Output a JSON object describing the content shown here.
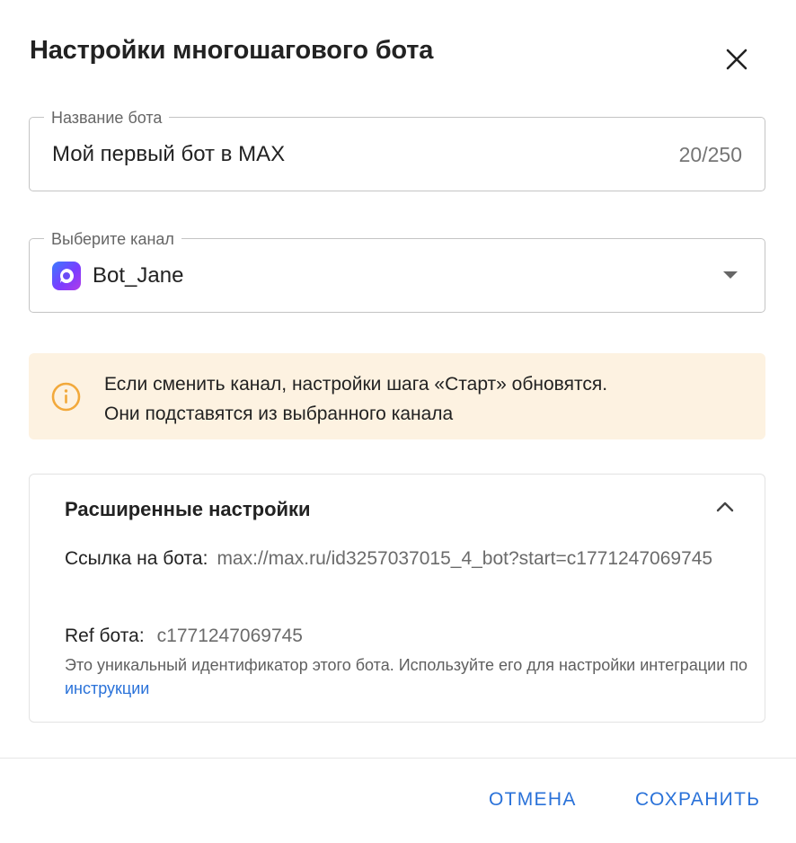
{
  "dialog": {
    "title": "Настройки многошагового бота",
    "close_icon": "close-icon"
  },
  "name_field": {
    "label": "Название бота",
    "value": "Мой первый бот в MAX",
    "counter": "20/250"
  },
  "channel_field": {
    "label": "Выберите канал",
    "icon": "max-messenger-icon",
    "value": "Bot_Jane",
    "arrow_icon": "dropdown-arrow-icon"
  },
  "alert": {
    "icon": "info-icon",
    "line1": "Если сменить канал, настройки шага «Старт» обновятся.",
    "line2": "Они подставятся из выбранного канала",
    "background": "#fdf2e1",
    "icon_color": "#f2a93b"
  },
  "advanced": {
    "title": "Расширенные настройки",
    "toggle_icon": "chevron-up-icon",
    "link_label": "Ссылка на бота:",
    "link_value": "max://max.ru/id3257037015_4_bot?start=c1771247069745",
    "ref_label": "Ref бота:",
    "ref_value": "c1771247069745",
    "hint_text": "Это уникальный идентификатор этого бота. Используйте его для настройки интеграции по ",
    "hint_link": "инструкции"
  },
  "footer": {
    "cancel_label": "ОТМЕНА",
    "save_label": "СОХРАНИТЬ",
    "accent": "#2a72d9"
  }
}
